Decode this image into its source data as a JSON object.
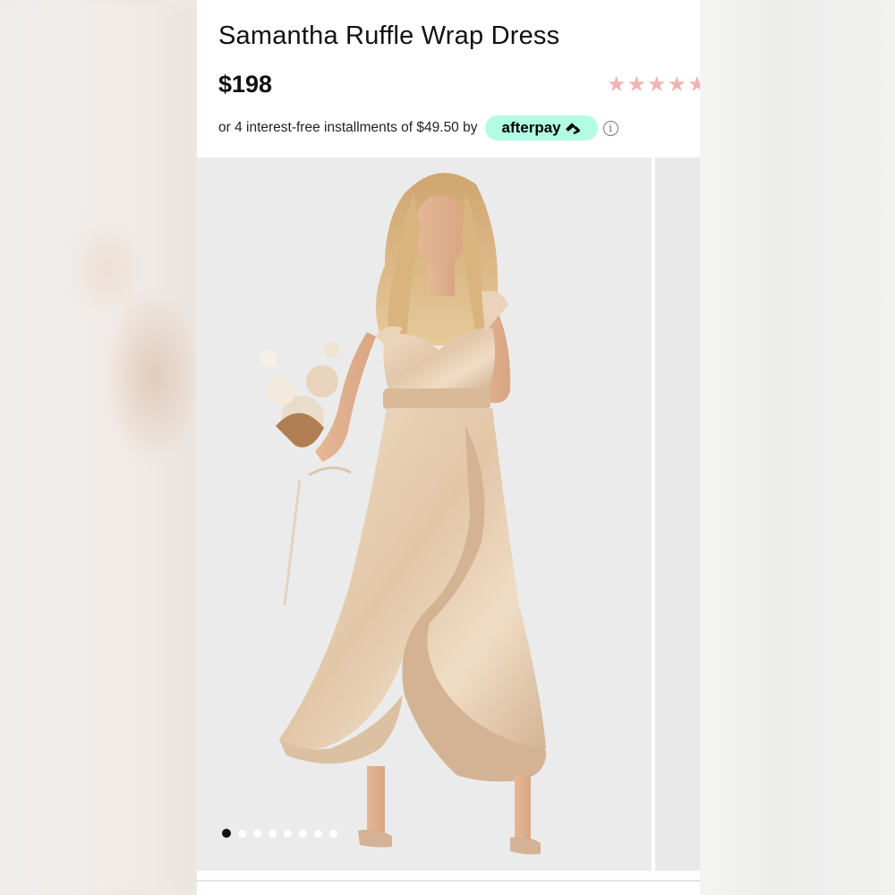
{
  "product": {
    "title": "Samantha Ruffle Wrap Dress",
    "price": "$198",
    "rating_stars": "★★★★★",
    "rating_color": "#f2b3b3"
  },
  "payment": {
    "installment_text": "or 4 interest-free installments of $49.50 by",
    "provider_label": "afterpay",
    "provider_icon": "afterpay-arrows-icon",
    "badge_color": "#b2fce4",
    "info_icon": "info-icon",
    "info_glyph": "i"
  },
  "gallery": {
    "image_description": "product-photo",
    "total_images": 8,
    "current_index": 1
  },
  "colors": {
    "dress": "#e6cfb5",
    "background": "#ebebeb"
  }
}
